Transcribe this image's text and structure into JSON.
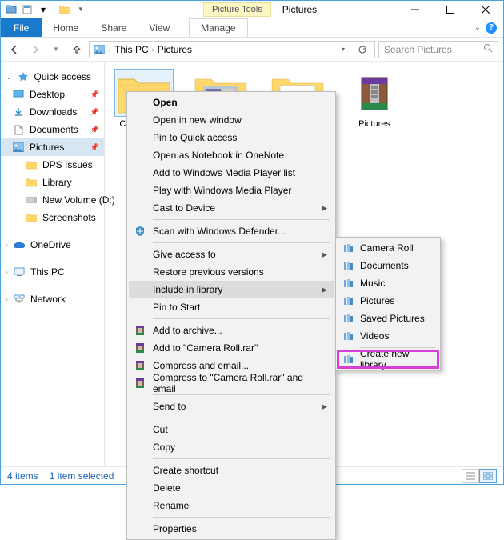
{
  "titlebar": {
    "contextual_group": "Picture Tools",
    "title": "Pictures"
  },
  "ribbon": {
    "file": "File",
    "tabs": [
      "Home",
      "Share",
      "View"
    ],
    "contextual_tab": "Manage"
  },
  "address": {
    "crumbs": [
      "This PC",
      "Pictures"
    ]
  },
  "search": {
    "placeholder": "Search Pictures"
  },
  "nav": {
    "quick_access": "Quick access",
    "items": [
      {
        "label": "Desktop",
        "pinned": true
      },
      {
        "label": "Downloads",
        "pinned": true
      },
      {
        "label": "Documents",
        "pinned": true
      },
      {
        "label": "Pictures",
        "pinned": true,
        "selected": true
      },
      {
        "label": "DPS Issues"
      },
      {
        "label": "Library"
      },
      {
        "label": "New Volume (D:)"
      },
      {
        "label": "Screenshots"
      }
    ],
    "onedrive": "OneDrive",
    "this_pc": "This PC",
    "network": "Network"
  },
  "content": {
    "items": [
      {
        "label": "Camera Roll",
        "type": "folder",
        "selected": true
      },
      {
        "label": "",
        "type": "folder-photo"
      },
      {
        "label": "",
        "type": "folder-photo"
      },
      {
        "label": "Pictures",
        "type": "rar"
      }
    ]
  },
  "status": {
    "count": "4 items",
    "selected": "1 item selected"
  },
  "ctx_main": [
    {
      "label": "Open",
      "bold": true
    },
    {
      "label": "Open in new window"
    },
    {
      "label": "Pin to Quick access"
    },
    {
      "label": "Open as Notebook in OneNote"
    },
    {
      "label": "Add to Windows Media Player list"
    },
    {
      "label": "Play with Windows Media Player"
    },
    {
      "label": "Cast to Device",
      "arrow": true
    },
    {
      "sep": true
    },
    {
      "label": "Scan with Windows Defender...",
      "icon": "defender"
    },
    {
      "sep": true
    },
    {
      "label": "Give access to",
      "arrow": true
    },
    {
      "label": "Restore previous versions"
    },
    {
      "label": "Include in library",
      "arrow": true,
      "hover": true
    },
    {
      "label": "Pin to Start"
    },
    {
      "sep": true
    },
    {
      "label": "Add to archive...",
      "icon": "rar"
    },
    {
      "label": "Add to \"Camera Roll.rar\"",
      "icon": "rar"
    },
    {
      "label": "Compress and email...",
      "icon": "rar"
    },
    {
      "label": "Compress to \"Camera Roll.rar\" and email",
      "icon": "rar"
    },
    {
      "sep": true
    },
    {
      "label": "Send to",
      "arrow": true
    },
    {
      "sep": true
    },
    {
      "label": "Cut"
    },
    {
      "label": "Copy"
    },
    {
      "sep": true
    },
    {
      "label": "Create shortcut"
    },
    {
      "label": "Delete"
    },
    {
      "label": "Rename"
    },
    {
      "sep": true
    },
    {
      "label": "Properties"
    }
  ],
  "ctx_sub": [
    {
      "label": "Camera Roll",
      "icon": "lib"
    },
    {
      "label": "Documents",
      "icon": "lib"
    },
    {
      "label": "Music",
      "icon": "lib"
    },
    {
      "label": "Pictures",
      "icon": "lib"
    },
    {
      "label": "Saved Pictures",
      "icon": "lib"
    },
    {
      "label": "Videos",
      "icon": "lib"
    },
    {
      "sep": true
    },
    {
      "label": "Create new library",
      "icon": "lib",
      "highlight": true
    }
  ]
}
